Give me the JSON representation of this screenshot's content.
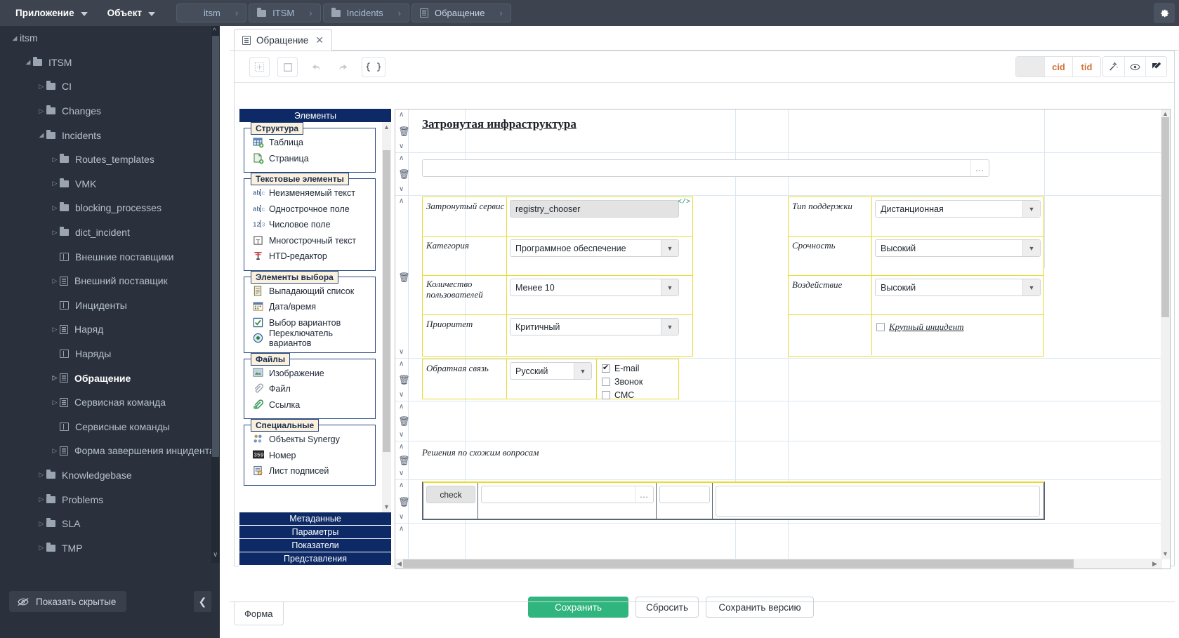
{
  "topbar": {
    "menus": [
      {
        "label": "Приложение",
        "icon": "chevron-down-icon"
      },
      {
        "label": "Объект",
        "icon": "chevron-down-icon"
      }
    ],
    "breadcrumbs": [
      {
        "label": "itsm",
        "icon": "",
        "arrow": "›"
      },
      {
        "label": "ITSM",
        "icon": "folder-icon",
        "arrow": "›"
      },
      {
        "label": "Incidents",
        "icon": "folder-icon",
        "arrow": "›"
      },
      {
        "label": "Обращение",
        "icon": "document-icon",
        "arrow": "›"
      }
    ],
    "settings_icon": "gear-icon"
  },
  "sidebar": {
    "tree": [
      {
        "label": "itsm",
        "indent": 0,
        "twist": "◢",
        "icon": "none"
      },
      {
        "label": "ITSM",
        "indent": 1,
        "twist": "◢",
        "icon": "folder"
      },
      {
        "label": "CI",
        "indent": 2,
        "twist": "▷",
        "icon": "folder"
      },
      {
        "label": "Changes",
        "indent": 2,
        "twist": "▷",
        "icon": "folder"
      },
      {
        "label": "Incidents",
        "indent": 2,
        "twist": "◢",
        "icon": "folder"
      },
      {
        "label": "Routes_templates",
        "indent": 3,
        "twist": "▷",
        "icon": "folder"
      },
      {
        "label": "VMK",
        "indent": 3,
        "twist": "▷",
        "icon": "folder"
      },
      {
        "label": "blocking_processes",
        "indent": 3,
        "twist": "▷",
        "icon": "folder"
      },
      {
        "label": "dict_incident",
        "indent": 3,
        "twist": "▷",
        "icon": "folder"
      },
      {
        "label": "Внешние поставщики",
        "indent": 3,
        "twist": "none",
        "icon": "grid"
      },
      {
        "label": "Внешний поставщик",
        "indent": 3,
        "twist": "▷",
        "icon": "doc"
      },
      {
        "label": "Инциденты",
        "indent": 3,
        "twist": "none",
        "icon": "grid"
      },
      {
        "label": "Наряд",
        "indent": 3,
        "twist": "▷",
        "icon": "doc"
      },
      {
        "label": "Наряды",
        "indent": 3,
        "twist": "none",
        "icon": "grid"
      },
      {
        "label": "Обращение",
        "indent": 3,
        "twist": "▷",
        "icon": "doc",
        "selected": true
      },
      {
        "label": "Сервисная команда",
        "indent": 3,
        "twist": "▷",
        "icon": "doc"
      },
      {
        "label": "Сервисные команды",
        "indent": 3,
        "twist": "none",
        "icon": "grid"
      },
      {
        "label": "Форма завершения инцидента",
        "indent": 3,
        "twist": "▷",
        "icon": "doc"
      },
      {
        "label": "Knowledgebase",
        "indent": 2,
        "twist": "▷",
        "icon": "folder"
      },
      {
        "label": "Problems",
        "indent": 2,
        "twist": "▷",
        "icon": "folder"
      },
      {
        "label": "SLA",
        "indent": 2,
        "twist": "▷",
        "icon": "folder"
      },
      {
        "label": "TMP",
        "indent": 2,
        "twist": "▷",
        "icon": "folder"
      }
    ],
    "show_hidden_label": "Показать скрытые",
    "show_hidden_icon": "eye-slash-icon",
    "collapse_icon": "chevron-left-icon"
  },
  "editor": {
    "tab_label": "Обращение",
    "tab_icon": "document-icon",
    "tab_close_icon": "close-icon",
    "toolbar": {
      "buttons": [
        {
          "name": "insert-table-icon",
          "glyph": "⬚"
        },
        {
          "name": "insert-block-icon",
          "glyph": "□"
        },
        {
          "name": "undo-icon",
          "glyph": "↶"
        },
        {
          "name": "redo-icon",
          "glyph": "↷"
        },
        {
          "name": "code-braces-icon",
          "glyph": "{ }"
        }
      ],
      "cid_label": "cid",
      "tid_label": "tid",
      "right_icons": [
        {
          "name": "magic-wand-icon",
          "glyph": "✦"
        },
        {
          "name": "eye-icon",
          "glyph": "◉"
        },
        {
          "name": "edit-icon",
          "glyph": "✎"
        }
      ]
    }
  },
  "palette": {
    "header": "Элементы",
    "groups": [
      {
        "legend": "Структура",
        "items": [
          {
            "label": "Таблица",
            "icon": "table-add-icon"
          },
          {
            "label": "Страница",
            "icon": "page-add-icon"
          }
        ]
      },
      {
        "legend": "Текстовые элементы",
        "items": [
          {
            "label": "Неизменяемый текст",
            "icon": "static-text-icon"
          },
          {
            "label": "Однострочное поле",
            "icon": "single-line-icon"
          },
          {
            "label": "Числовое поле",
            "icon": "number-field-icon"
          },
          {
            "label": "Многострочный текст",
            "icon": "multiline-text-icon"
          },
          {
            "label": "HTD-редактор",
            "icon": "htd-editor-icon"
          }
        ]
      },
      {
        "legend": "Элементы выбора",
        "items": [
          {
            "label": "Выпадающий список",
            "icon": "dropdown-icon"
          },
          {
            "label": "Дата/время",
            "icon": "calendar-icon"
          },
          {
            "label": "Выбор вариантов",
            "icon": "checkbox-icon"
          },
          {
            "label": "Переключатель вариантов",
            "icon": "radio-icon"
          }
        ]
      },
      {
        "legend": "Файлы",
        "items": [
          {
            "label": "Изображение",
            "icon": "image-icon"
          },
          {
            "label": "Файл",
            "icon": "paperclip-icon"
          },
          {
            "label": "Ссылка",
            "icon": "link-icon"
          }
        ]
      },
      {
        "legend": "Специальные",
        "items": [
          {
            "label": "Объекты Synergy",
            "icon": "synergy-objects-icon"
          },
          {
            "label": "Номер",
            "icon": "number-counter-icon"
          },
          {
            "label": "Лист подписей",
            "icon": "signature-sheet-icon"
          }
        ]
      }
    ],
    "tabs": [
      "Метаданные",
      "Параметры",
      "Показатели",
      "Представления"
    ]
  },
  "form": {
    "section_title": "Затронутая инфраструктура",
    "left_fields": [
      {
        "label": "Затронутый сервис",
        "value": "registry_chooser",
        "control": "registry",
        "code_marker": "</>"
      },
      {
        "label": "Категория",
        "value": "Программное обеспечение",
        "control": "dropdown"
      },
      {
        "label": "Количество\nпользователей",
        "value": "Менее 10",
        "control": "dropdown"
      },
      {
        "label": "Приоритет",
        "value": "Критичный",
        "control": "dropdown"
      }
    ],
    "right_fields": [
      {
        "label": "Тип поддержки",
        "value": "Дистанционная",
        "control": "dropdown"
      },
      {
        "label": "Срочность",
        "value": "Высокий",
        "control": "dropdown"
      },
      {
        "label": "Воздействие",
        "value": "Высокий",
        "control": "dropdown"
      }
    ],
    "major_incident": {
      "label": "Крупный инцидент",
      "checked": false
    },
    "feedback": {
      "label": "Обратная связь",
      "language": "Русский",
      "channels": [
        {
          "label": "E-mail",
          "checked": true
        },
        {
          "label": "Звонок",
          "checked": false
        },
        {
          "label": "СМС",
          "checked": false
        }
      ]
    },
    "similar_solutions_label": "Решения по схожим вопросам",
    "check_row": {
      "tag": "check",
      "dots": "…"
    },
    "gutter_icons": {
      "up": "∧",
      "down": "∨",
      "delete": "delete-icon"
    }
  },
  "actions": {
    "save": "Сохранить",
    "reset": "Сбросить",
    "save_version": "Сохранить версию"
  },
  "bottom_tabs": {
    "form": "Форма"
  },
  "colors": {
    "topbar_bg": "#3d4450",
    "sidebar_bg": "#2b313c",
    "accent_blue": "#0e2a66",
    "primary_green": "#31b57f",
    "field_highlight": "#e8dc2f",
    "cid_orange": "#d1743a"
  }
}
